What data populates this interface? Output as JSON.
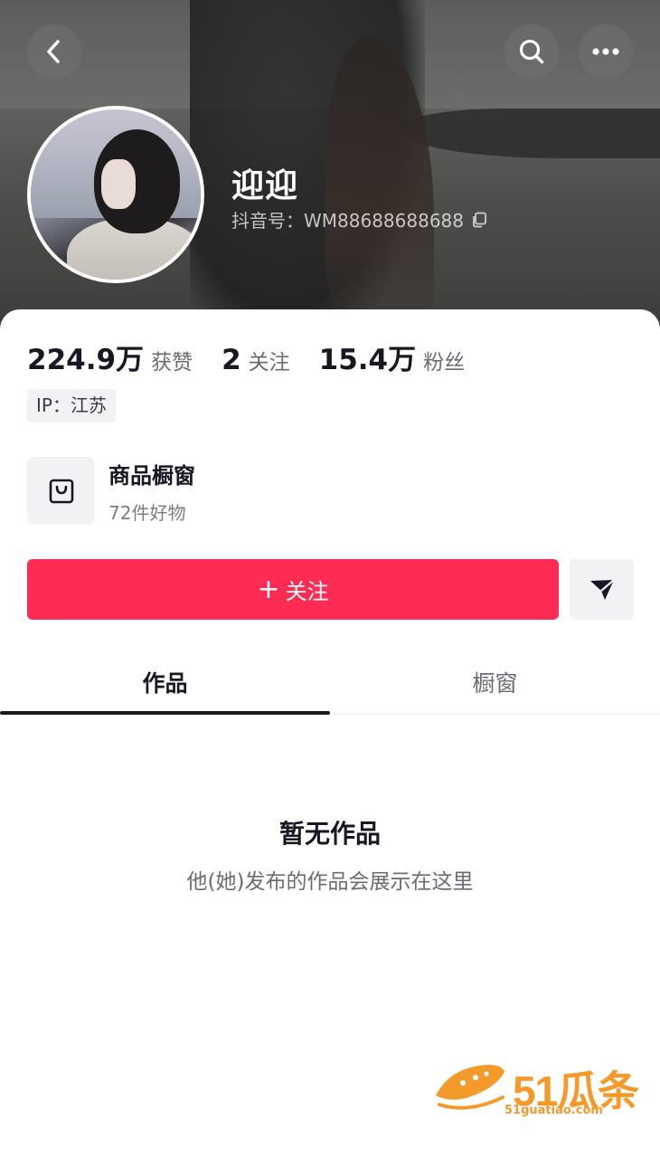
{
  "profile": {
    "nickname": "迎迎",
    "douyin_id": "抖音号：WM88688688688"
  },
  "stats": [
    {
      "value": "224.9万",
      "label": "获赞"
    },
    {
      "value": "2",
      "label": "关注"
    },
    {
      "value": "15.4万",
      "label": "粉丝"
    }
  ],
  "ip_location": "IP：江苏",
  "shop": {
    "title": "商品橱窗",
    "subtitle": "72件好物"
  },
  "actions": {
    "follow_plus": "+",
    "follow_label": "关注"
  },
  "tabs": [
    {
      "label": "作品",
      "active": true
    },
    {
      "label": "橱窗",
      "active": false
    }
  ],
  "empty_state": {
    "title": "暂无作品",
    "subtitle": "他(她)发布的作品会展示在这里"
  },
  "watermark": {
    "brand": "51瓜条",
    "site": "51guatiao.com"
  },
  "colors": {
    "accent": "#fe2c55",
    "watermark": "#f39a2b"
  },
  "icons": [
    "back-icon",
    "search-icon",
    "more-icon",
    "copy-icon",
    "shopping-bag-icon",
    "share-icon"
  ]
}
